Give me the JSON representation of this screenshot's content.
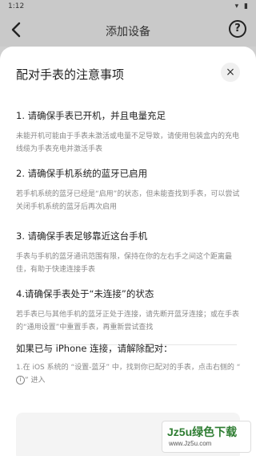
{
  "status_bar": {
    "time": "1:12",
    "icons": "▾ ▮"
  },
  "header": {
    "title": "添加设备",
    "help_glyph": "?"
  },
  "sheet": {
    "title": "配对手表的注意事项",
    "close_glyph": "×",
    "sections": [
      {
        "heading": "1. 请确保手表已开机，并且电量充足",
        "body": "未能开机可能由于手表未激活或电量不足导致，请使用包装盒内的充电线缆为手表充电并激活手表"
      },
      {
        "heading": "2. 请确保手机系统的蓝牙已启用",
        "body": "若手机系统的蓝牙已经是“启用”的状态，但未能查找到手表，可以尝试关闭手机系统的蓝牙后再次启用"
      },
      {
        "heading": "3. 请确保手表足够靠近这台手机",
        "body": "手表与手机的蓝牙通讯范围有限，保持在你的左右手之间这个距离最佳，有助于快速连接手表"
      },
      {
        "heading": "4.请确保手表处于“未连接”的状态",
        "body": "若手表已与其他手机的蓝牙正处于连接，请先断开蓝牙连接；或在手表的“通用设置”中重置手表，再重新尝试查找"
      }
    ],
    "iphone": {
      "title": "如果已与 iPhone 连接，请解除配对：",
      "step_prefix": "1.在 iOS 系统的 “设置-蓝牙” 中，找到你已配对的手表，点击右侧的 “",
      "info_glyph": "i",
      "step_suffix": "” 进入"
    }
  },
  "watermark": {
    "main": "Jz5u绿色下载",
    "sub": "www.Jz5u.com"
  },
  "colors": {
    "overlay": "#c9c9c9",
    "watermark_green": "#2e7d32"
  }
}
